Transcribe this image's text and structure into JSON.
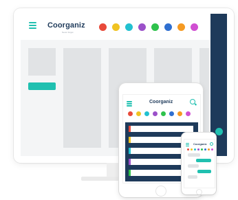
{
  "brand": {
    "name": "Coorganiz",
    "tagline": "Never forget"
  },
  "colors": {
    "accent": "#20c0b0",
    "navy": "#1e3a5a",
    "column_gray": "#e1e3e5"
  },
  "palette": [
    "#e84a3a",
    "#f0c322",
    "#22c1d0",
    "#9b50c9",
    "#2fc24c",
    "#2f6fd0",
    "#f59a22",
    "#d04fd2"
  ],
  "tablet_card_colors": [
    "#e84a3a",
    "#f0c322",
    "#22c1d0",
    "#9b50c9",
    "#2fc24c"
  ],
  "phone_bubble_colors": [
    "#e1e3e5",
    "#20c0b0",
    "#e1e3e5",
    "#20c0b0",
    "#e1e3e5"
  ],
  "icons": {
    "menu": "hamburger-menu-icon",
    "search": "search-icon"
  }
}
